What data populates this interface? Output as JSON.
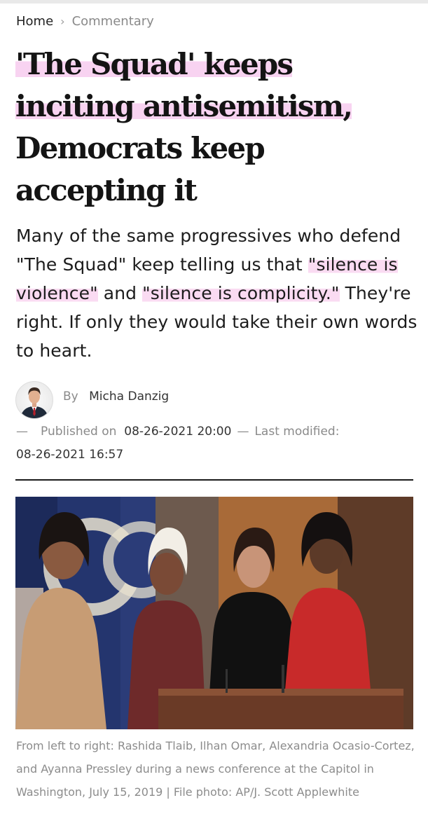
{
  "breadcrumb": {
    "home": "Home",
    "separator": "›",
    "current": "Commentary"
  },
  "headline": {
    "line1": "'The Squad' keeps",
    "line2": "inciting antisemitism,",
    "line3": "Democrats keep",
    "line4": "accepting it"
  },
  "dek": {
    "part1": "Many of the same progressives who defend \"The Squad\" keep telling us that ",
    "hl1": "\"silence is violence\"",
    "part2": " and ",
    "hl2": "\"silence is complicity.\"",
    "part3": " They're right. If only they would take their own words to heart."
  },
  "author": {
    "by": "By",
    "name": "Micha Danzig"
  },
  "meta": {
    "dash": "—",
    "published_label": "Published on",
    "published": "08-26-2021 20:00",
    "modified_label": "Last modified:",
    "modified": "08-26-2021 16:57"
  },
  "photo": {
    "caption": "From left to right: Rashida Tlaib, Ilhan Omar, Alexandria Ocasio-Cortez, and Ayanna Pressley during a news conference at the Capitol in Washington, July 15, 2019 | File photo: AP/J. Scott Applewhite"
  },
  "colors": {
    "highlight": "#f0a0e0",
    "text": "#1a1a1a",
    "muted": "#8a8a8a"
  }
}
